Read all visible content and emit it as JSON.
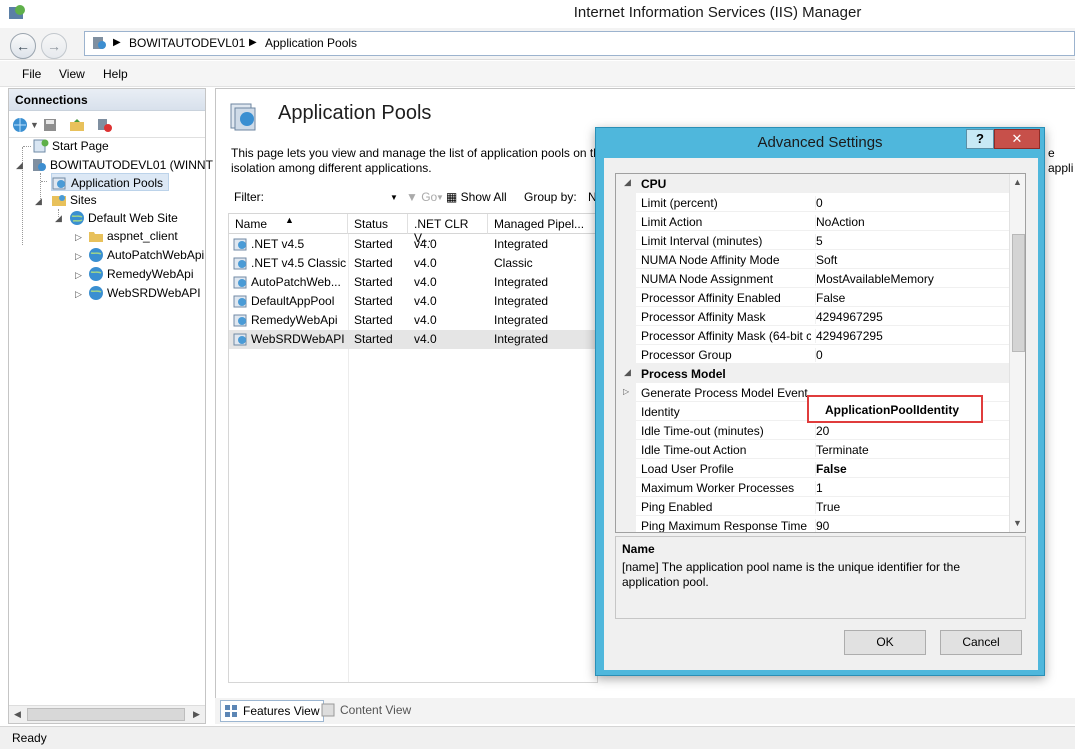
{
  "window": {
    "title": "Internet Information Services (IIS) Manager"
  },
  "address": {
    "crumbs": [
      "BOWITAUTODEVL01",
      "Application Pools"
    ]
  },
  "menu": {
    "items": [
      "File",
      "View",
      "Help"
    ]
  },
  "connections": {
    "header": "Connections",
    "tree": {
      "start_page": "Start Page",
      "server": "BOWITAUTODEVL01 (WINNT",
      "app_pools": "Application Pools",
      "sites": "Sites",
      "default_site": "Default Web Site",
      "children": [
        "aspnet_client",
        "AutoPatchWebApi",
        "RemedyWebApi",
        "WebSRDWebAPI"
      ]
    }
  },
  "main": {
    "title": "Application Pools",
    "desc_line1": "This page lets you view and manage the list of application pools on th",
    "desc_line2": "isolation among different applications.",
    "desc_tail": "e appli",
    "filter_label": "Filter:",
    "go_label": "Go",
    "show_all_label": "Show All",
    "group_by_label": "Group by:",
    "group_by_value": "N",
    "columns": [
      "Name",
      "Status",
      ".NET CLR V...",
      "Managed Pipel..."
    ],
    "rows": [
      {
        "name": ".NET v4.5",
        "status": "Started",
        "clr": "v4.0",
        "pipeline": "Integrated"
      },
      {
        "name": ".NET v4.5 Classic",
        "status": "Started",
        "clr": "v4.0",
        "pipeline": "Classic"
      },
      {
        "name": "AutoPatchWeb...",
        "status": "Started",
        "clr": "v4.0",
        "pipeline": "Integrated"
      },
      {
        "name": "DefaultAppPool",
        "status": "Started",
        "clr": "v4.0",
        "pipeline": "Integrated"
      },
      {
        "name": "RemedyWebApi",
        "status": "Started",
        "clr": "v4.0",
        "pipeline": "Integrated"
      },
      {
        "name": "WebSRDWebAPI",
        "status": "Started",
        "clr": "v4.0",
        "pipeline": "Integrated"
      }
    ],
    "selected_row": 5
  },
  "view_tabs": {
    "features": "Features View",
    "content": "Content View"
  },
  "status": {
    "text": "Ready"
  },
  "dialog": {
    "title": "Advanced Settings",
    "help": "?",
    "close": "✕",
    "categories": {
      "cpu": "CPU",
      "process_model": "Process Model"
    },
    "cpu_props": [
      {
        "name": "Limit (percent)",
        "value": "0"
      },
      {
        "name": "Limit Action",
        "value": "NoAction"
      },
      {
        "name": "Limit Interval (minutes)",
        "value": "5"
      },
      {
        "name": "NUMA Node Affinity Mode",
        "value": "Soft"
      },
      {
        "name": "NUMA Node Assignment",
        "value": "MostAvailableMemory"
      },
      {
        "name": "Processor Affinity Enabled",
        "value": "False"
      },
      {
        "name": "Processor Affinity Mask",
        "value": "4294967295"
      },
      {
        "name": "Processor Affinity Mask (64-bit c",
        "value": "4294967295"
      },
      {
        "name": "Processor Group",
        "value": "0"
      }
    ],
    "process_props": [
      {
        "name": "Generate Process Model Event L",
        "value": ""
      },
      {
        "name": "Identity",
        "value": ""
      },
      {
        "name": "Idle Time-out (minutes)",
        "value": "20"
      },
      {
        "name": "Idle Time-out Action",
        "value": "Terminate"
      },
      {
        "name": "Load User Profile",
        "value": "False"
      },
      {
        "name": "Maximum Worker Processes",
        "value": "1"
      },
      {
        "name": "Ping Enabled",
        "value": "True"
      },
      {
        "name": "Ping Maximum Response Time (",
        "value": "90"
      }
    ],
    "identity_value": "ApplicationPoolIdentity",
    "desc_title": "Name",
    "desc_body": "[name] The application pool name is the unique identifier for the application pool.",
    "ok": "OK",
    "cancel": "Cancel"
  }
}
